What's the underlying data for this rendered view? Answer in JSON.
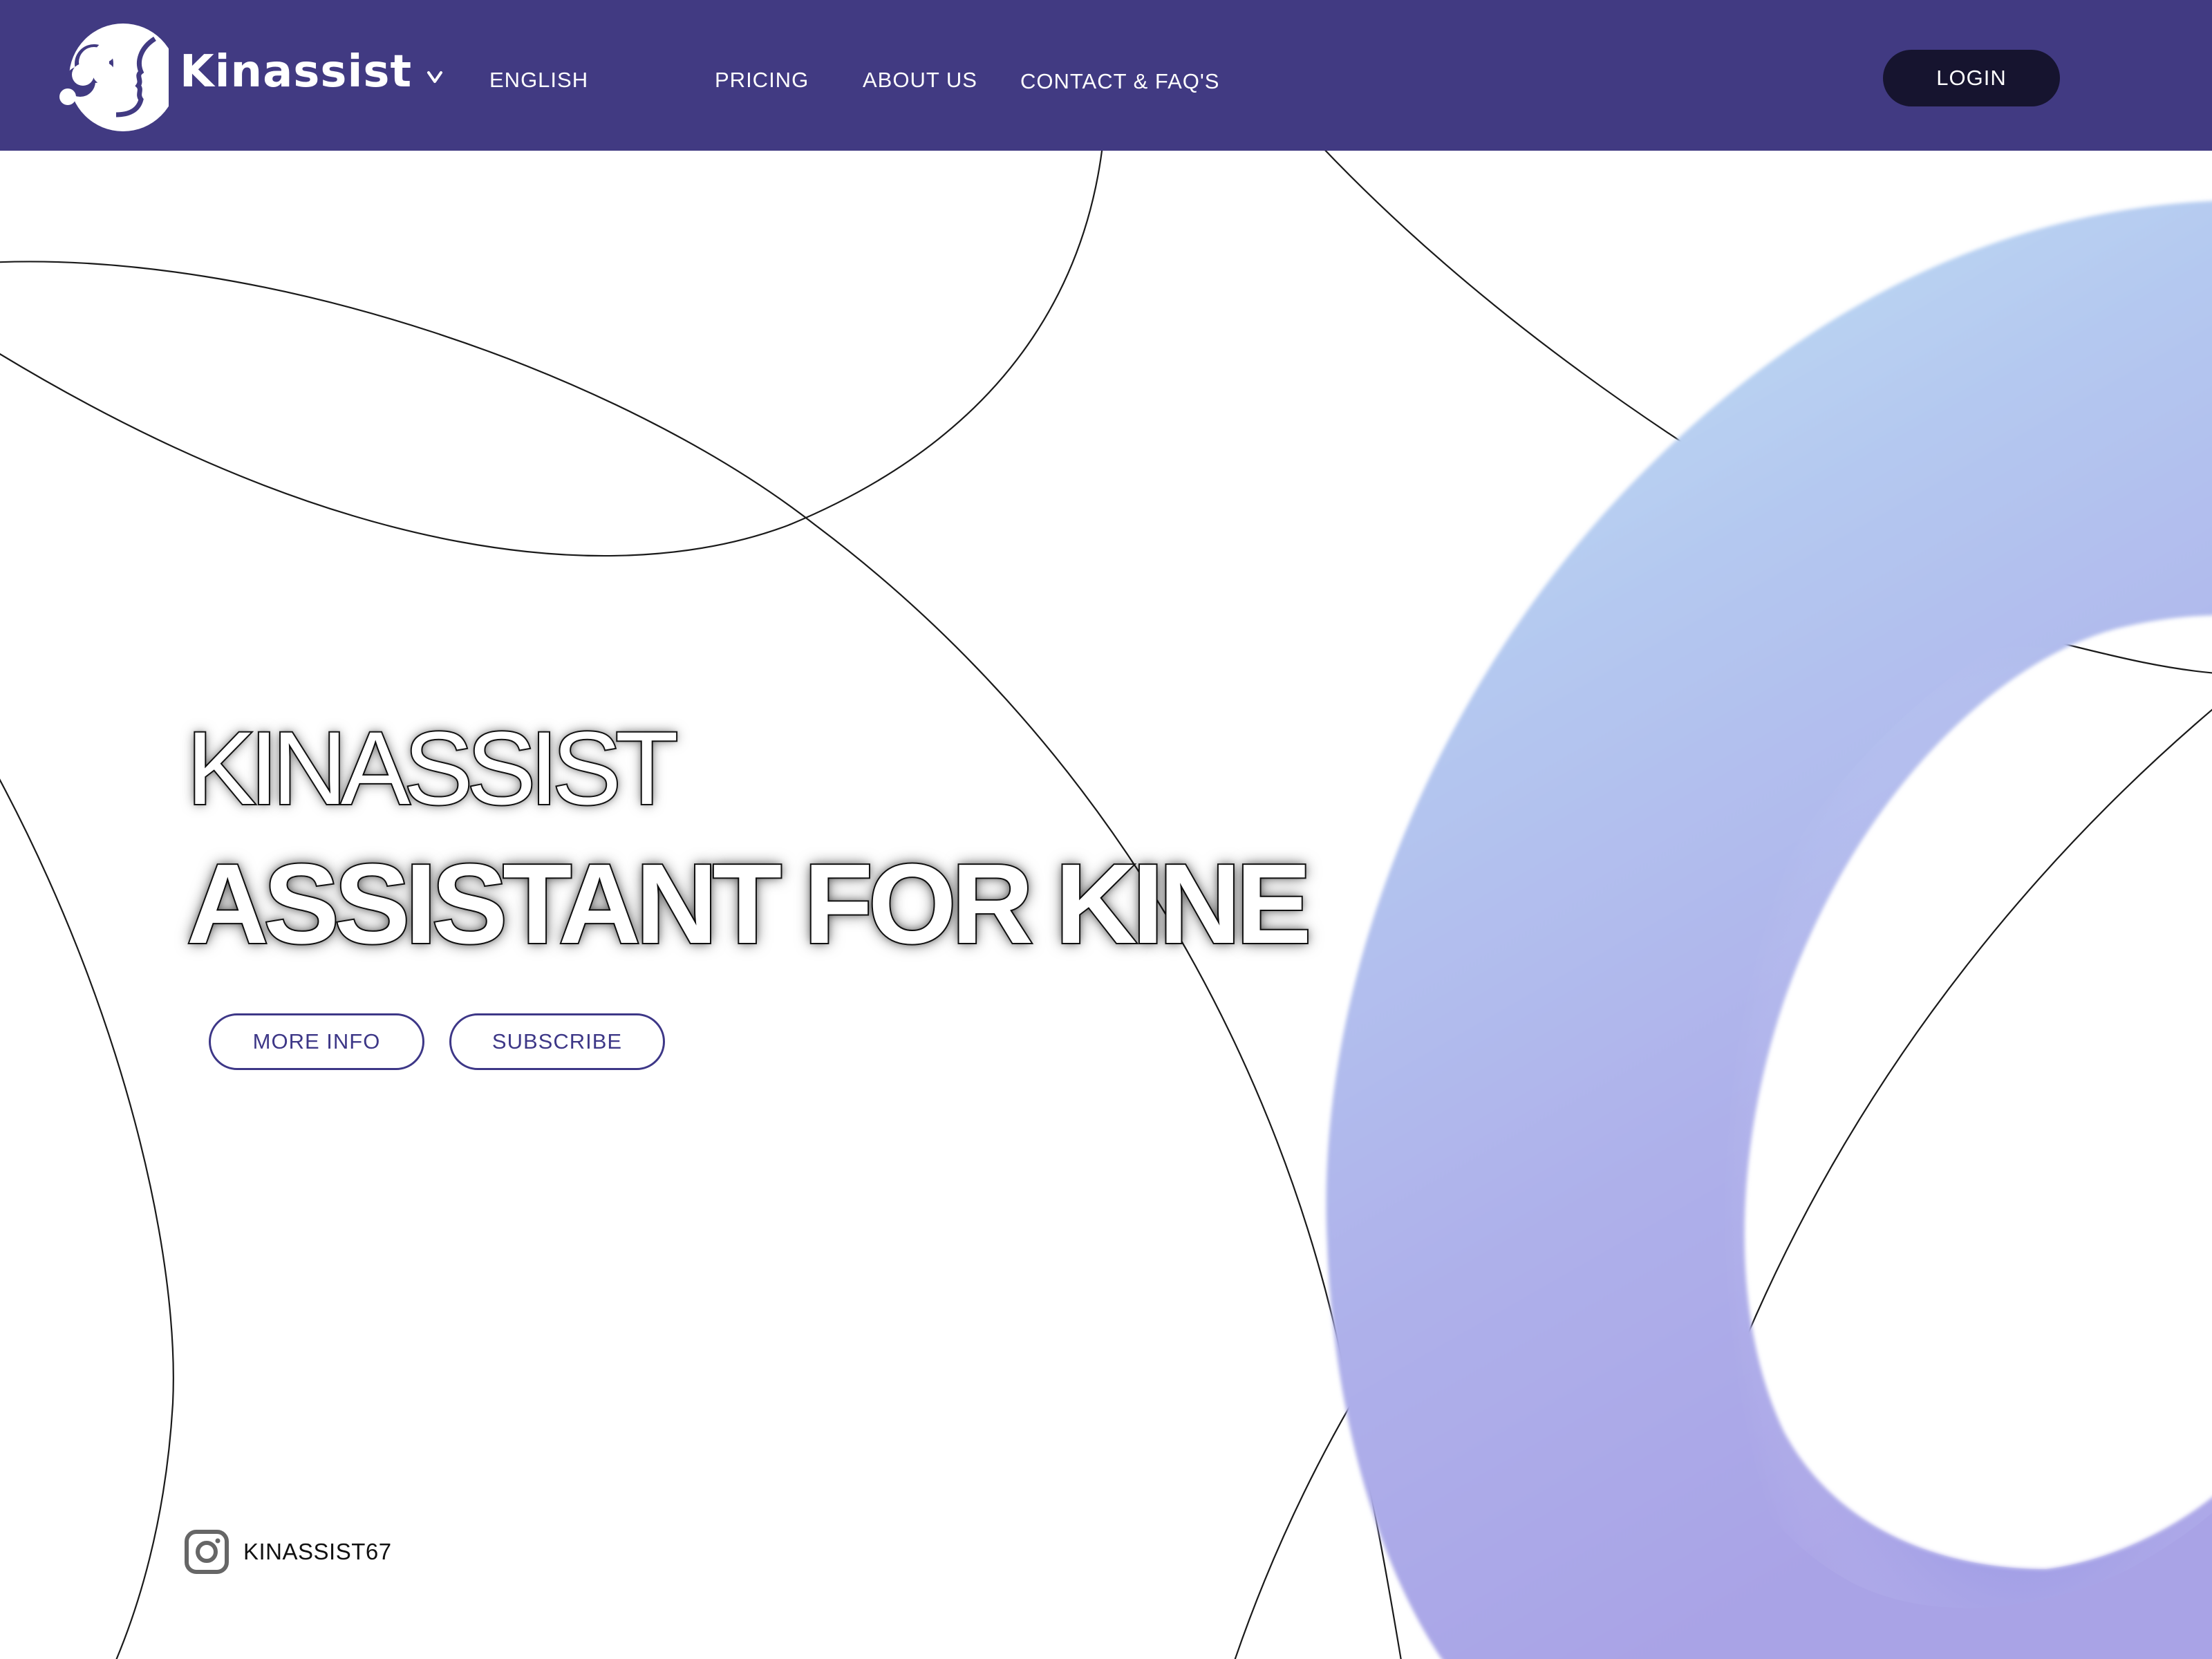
{
  "header": {
    "brand_name": "Kinassist",
    "language_label": "ENGLISH",
    "nav": {
      "pricing": "PRICING",
      "about": "ABOUT US",
      "contact": "CONTACT & FAQ'S"
    },
    "login_label": "LOGIN"
  },
  "hero": {
    "eyebrow": "KINASSIST",
    "title": "ASSISTANT FOR KINE",
    "buttons": {
      "more_info": "MORE INFO",
      "subscribe": "SUBSCRIBE"
    }
  },
  "social": {
    "icon": "instagram-icon",
    "handle": "KINASSIST67"
  },
  "colors": {
    "header_bg": "#413a82",
    "login_bg": "#16142f",
    "accent": "#3d3787",
    "torus_light": "#bfe0f4",
    "torus_mid": "#a9b6ec",
    "torus_deep": "#7f86e0"
  },
  "icons": {
    "logo": "head-profile-logo-icon",
    "language_dropdown": "chevron-down-icon"
  }
}
